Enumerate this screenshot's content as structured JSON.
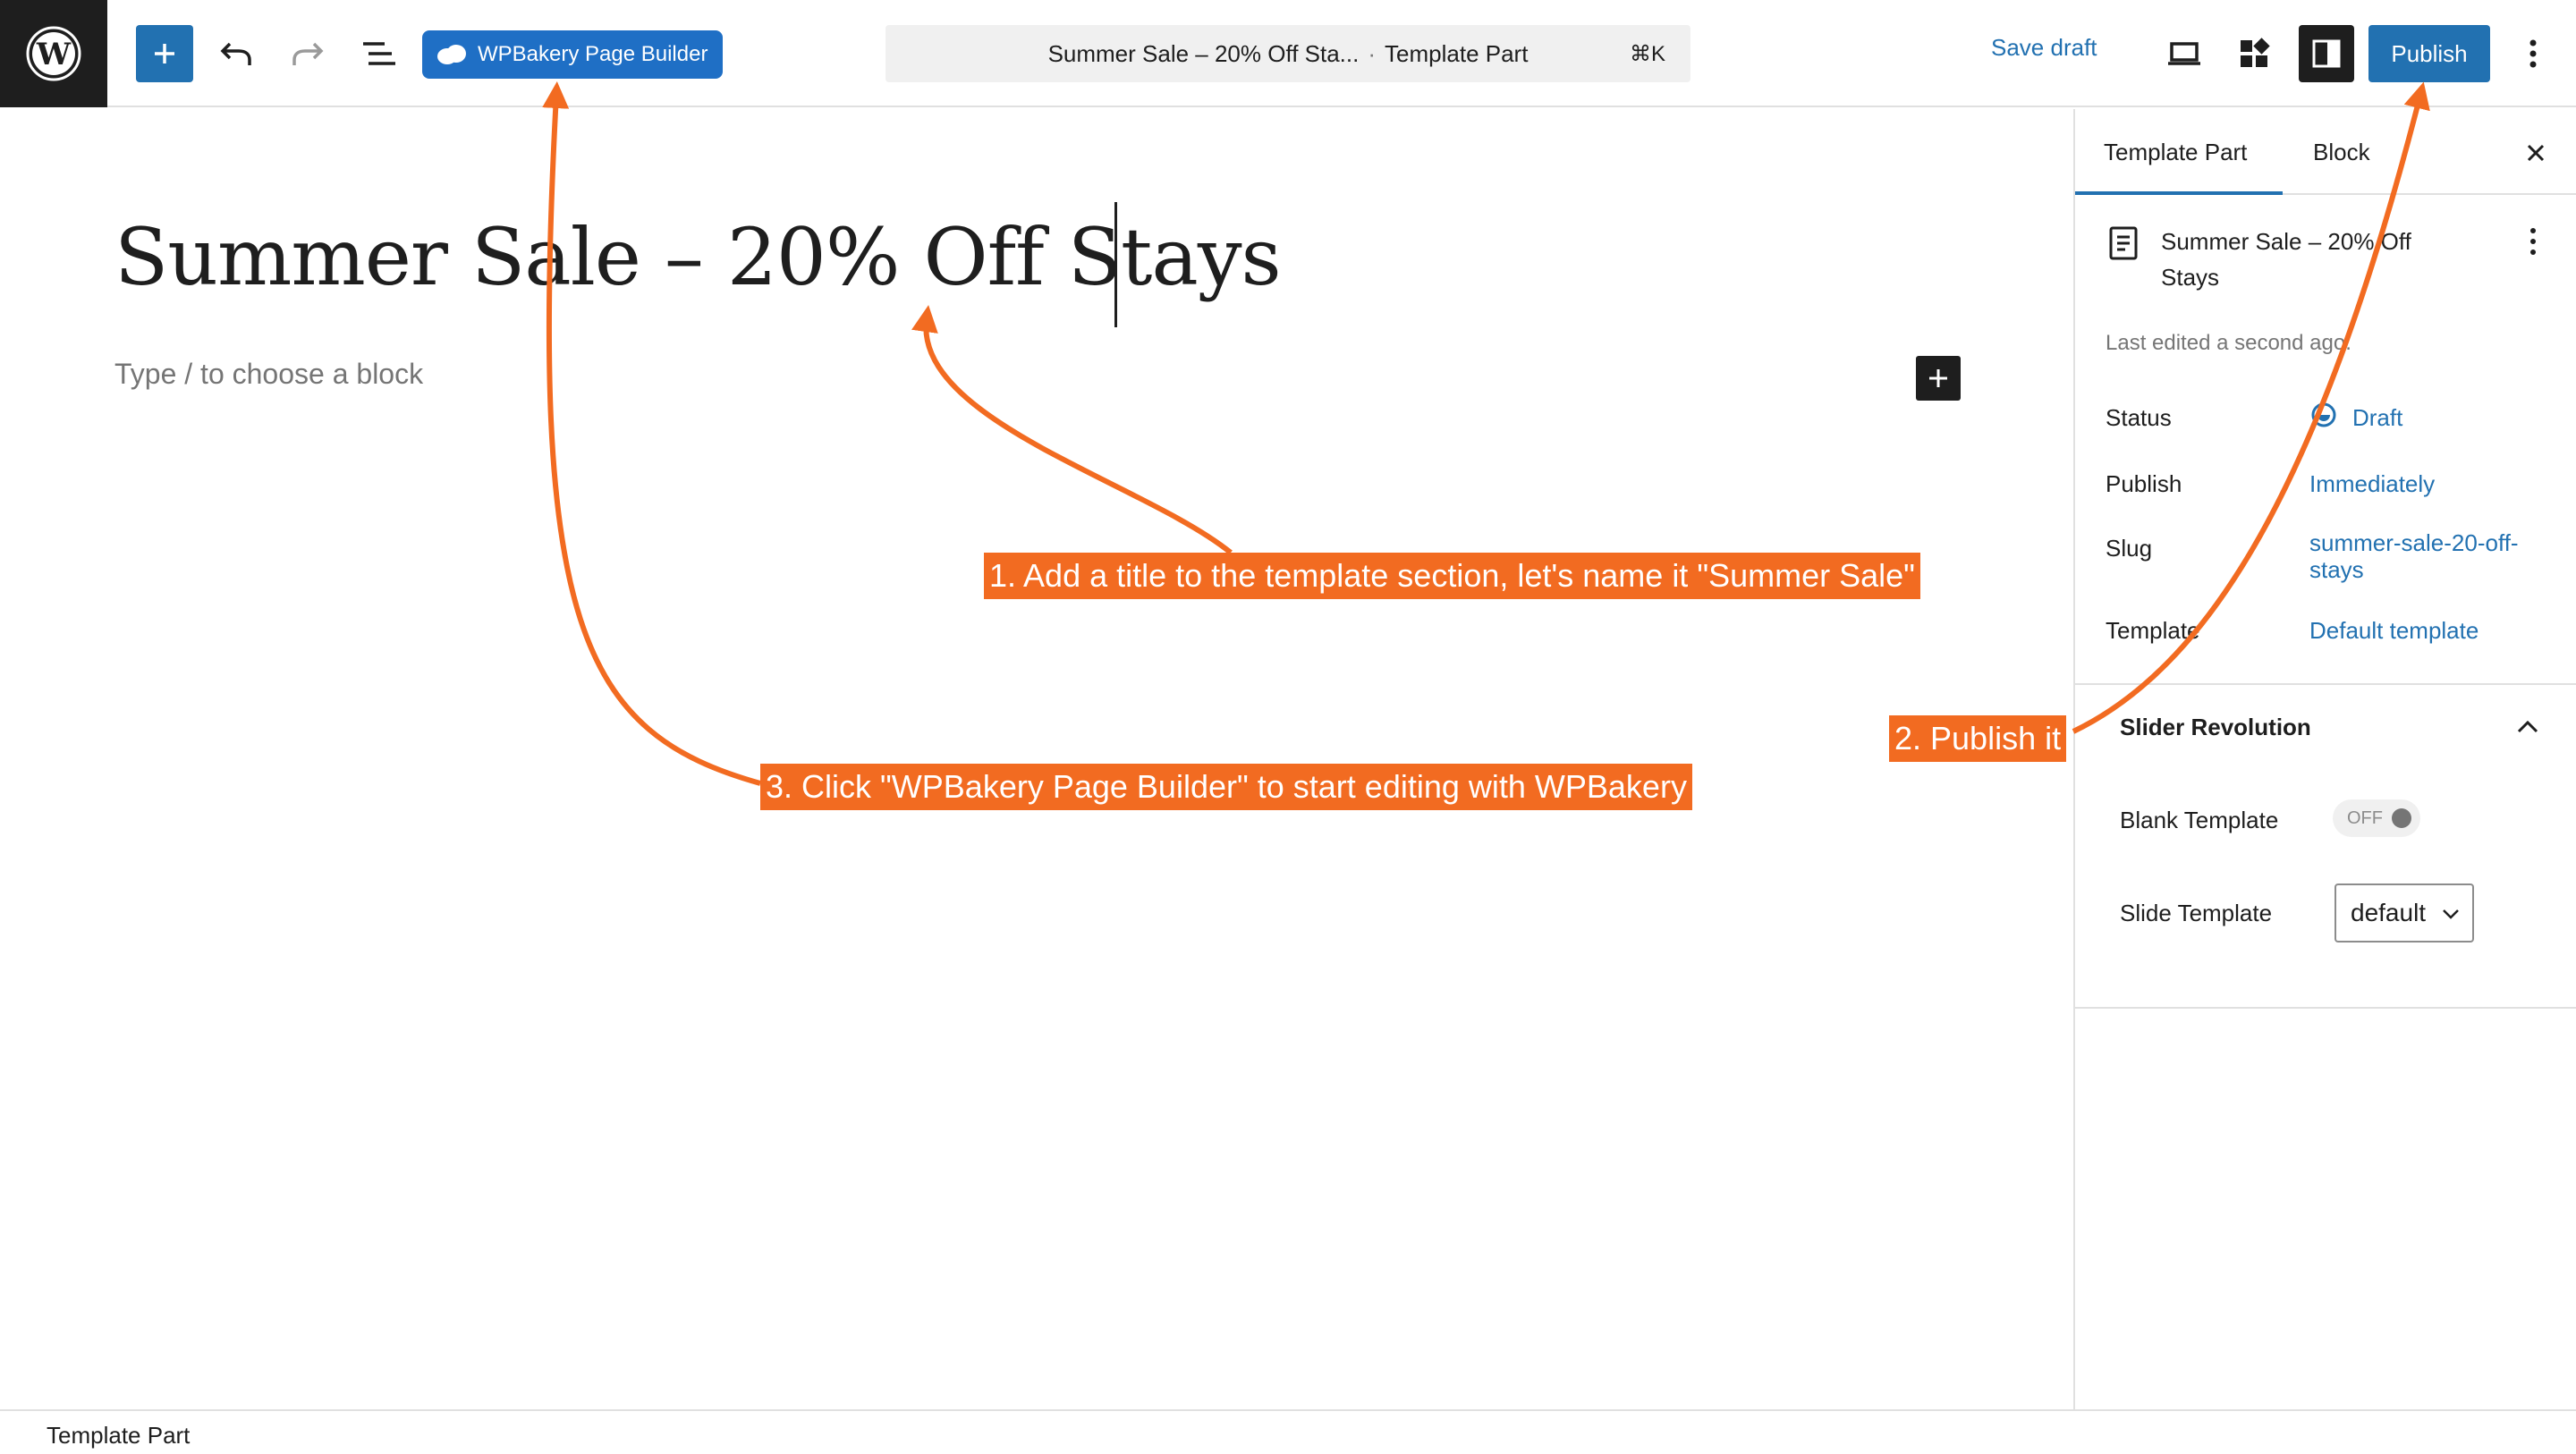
{
  "topbar": {
    "builder_button": "WPBakery Page Builder",
    "doc_title": "Summer Sale – 20% Off Sta...",
    "doc_separator": "·",
    "doc_type": "Template Part",
    "shortcut": "⌘K",
    "save_draft": "Save draft",
    "publish": "Publish"
  },
  "editor": {
    "title": "Summer Sale – 20% Off Stays",
    "placeholder": "Type / to choose a block"
  },
  "sidebar": {
    "tabs": [
      "Template Part",
      "Block"
    ],
    "doc_title": "Summer Sale – 20% Off Stays",
    "last_edited": "Last edited a second ago.",
    "rows": [
      {
        "label": "Status",
        "value": "Draft"
      },
      {
        "label": "Publish",
        "value": "Immediately"
      },
      {
        "label": "Slug",
        "value": "summer-sale-20-off-stays"
      },
      {
        "label": "Template",
        "value": "Default template"
      }
    ],
    "panel": {
      "title": "Slider Revolution",
      "blank_template_label": "Blank Template",
      "toggle_state": "OFF",
      "slide_template_label": "Slide Template",
      "slide_template_value": "default"
    }
  },
  "footer": {
    "breadcrumb": "Template Part"
  },
  "annotations": {
    "step1": "1. Add a title to the template section, let's name it \"Summer Sale\"",
    "step2": "2. Publish it",
    "step3": "3. Click \"WPBakery Page Builder\" to start editing with WPBakery"
  },
  "colors": {
    "accent": "#2271b1",
    "wpbakery": "#1f6fc5",
    "annotation": "#f26b21",
    "dark": "#1e1e1e"
  }
}
